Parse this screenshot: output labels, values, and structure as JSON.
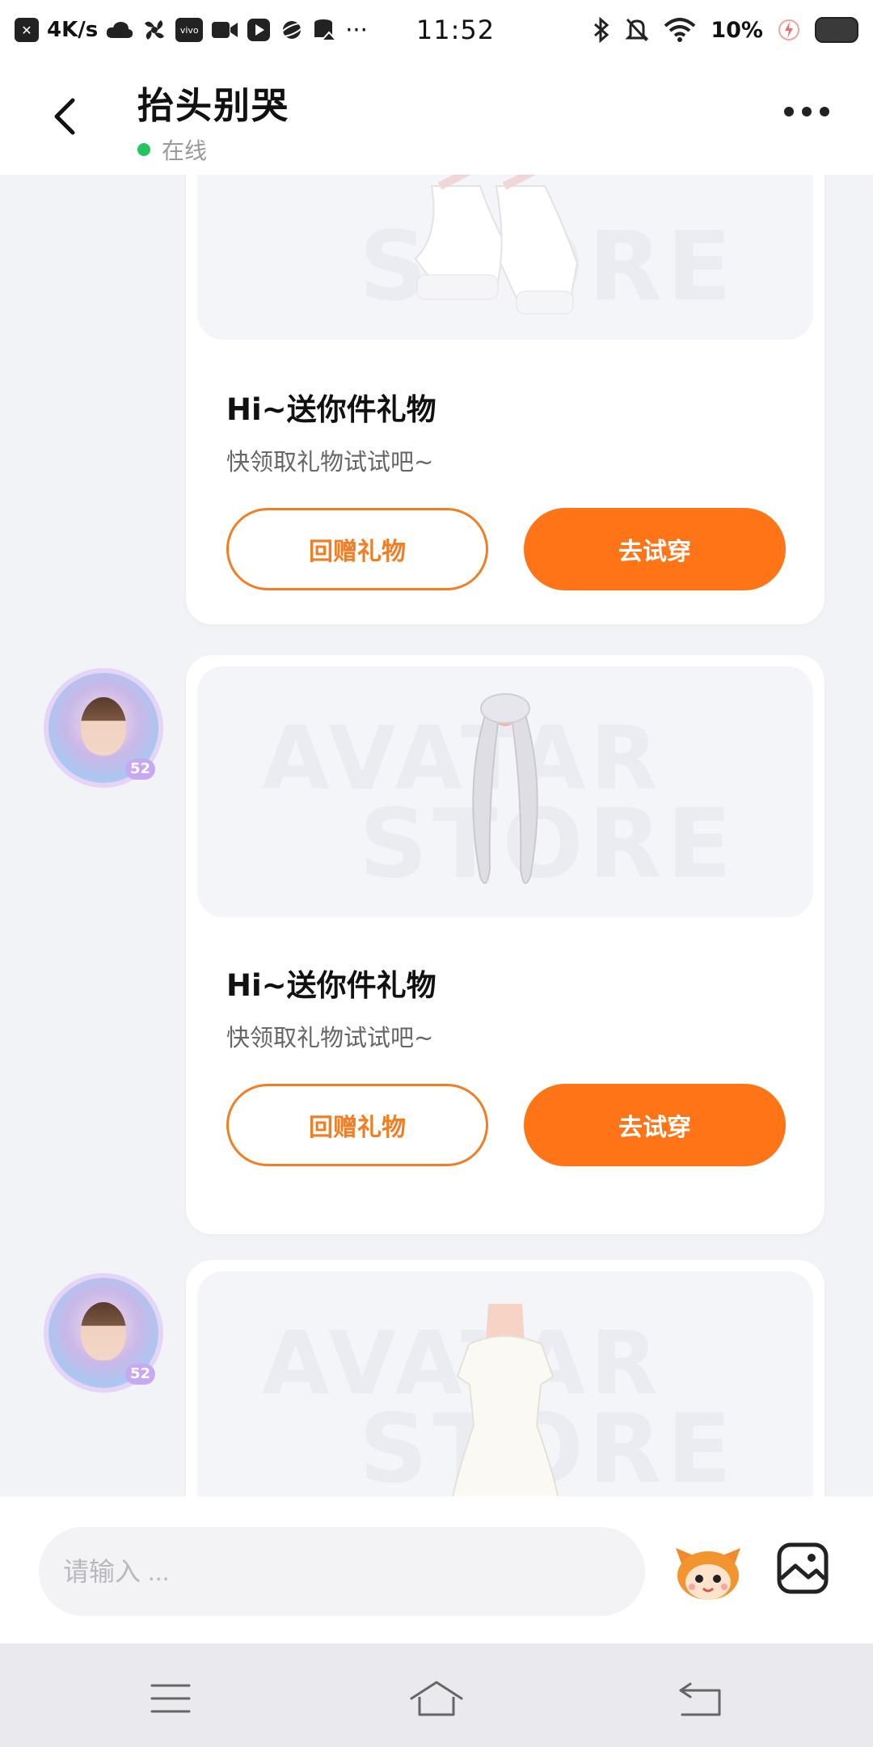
{
  "status_bar": {
    "network_speed": "4K/s",
    "time": "11:52",
    "battery_percent": "10%",
    "icons": [
      "close-box-icon",
      "cloud-icon",
      "fan-icon",
      "vivo-icon",
      "video-icon",
      "play-icon",
      "planet-icon",
      "storage-icon",
      "more-dots-icon",
      "bluetooth-icon",
      "mute-bell-icon",
      "wifi-icon",
      "charging-icon",
      "battery-icon"
    ],
    "vivo_label": "vivo",
    "more": "···"
  },
  "header": {
    "title": "抬头别哭",
    "status": "在线",
    "status_color": "#22c55e"
  },
  "messages": [
    {
      "type": "gift",
      "watermark": [
        "STORE"
      ],
      "item": "white-platform-shoes",
      "title": "Hi~送你件礼物",
      "subtitle": "快领取礼物试试吧~",
      "btn_return": "回赠礼物",
      "btn_try": "去试穿"
    },
    {
      "type": "gift",
      "avatar_badge": "52",
      "watermark": [
        "AVATAR",
        "STORE"
      ],
      "item": "silver-twin-tails-hair",
      "title": "Hi~送你件礼物",
      "subtitle": "快领取礼物试试吧~",
      "btn_return": "回赠礼物",
      "btn_try": "去试穿"
    },
    {
      "type": "gift",
      "avatar_badge": "52",
      "watermark": [
        "AVATAR",
        "STORE"
      ],
      "item": "white-slip-dress"
    }
  ],
  "input": {
    "placeholder": "请输入 ..."
  },
  "colors": {
    "accent": "#ff7416",
    "background": "#f2f3f7"
  }
}
